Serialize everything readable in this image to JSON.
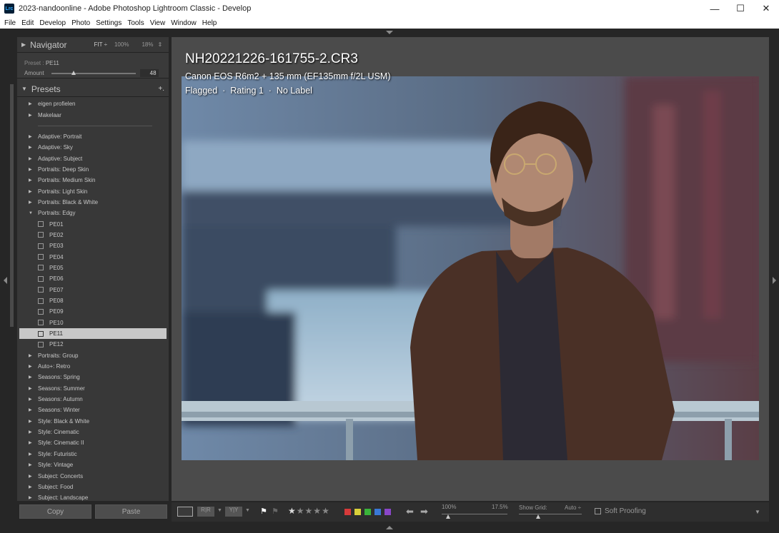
{
  "window": {
    "title": "2023-nandoonline - Adobe Photoshop Lightroom Classic - Develop",
    "app_icon": "Lrc"
  },
  "menu": [
    {
      "label": "File"
    },
    {
      "label": "Edit"
    },
    {
      "label": "Develop"
    },
    {
      "label": "Photo"
    },
    {
      "label": "Settings"
    },
    {
      "label": "Tools"
    },
    {
      "label": "View"
    },
    {
      "label": "Window"
    },
    {
      "label": "Help"
    }
  ],
  "navigator": {
    "title": "Navigator",
    "fit": "FIT ÷",
    "z100": "100%",
    "z18": "18%"
  },
  "preset_amount": {
    "preset_label": "Preset :",
    "preset_value": "PE11",
    "amount_label": "Amount",
    "amount_value": "48"
  },
  "presets": {
    "title": "Presets",
    "add": "+.",
    "items": [
      {
        "label": "eigen profielen",
        "kind": "folder"
      },
      {
        "label": "Makelaar",
        "kind": "folder"
      },
      {
        "label": "",
        "kind": "sep"
      },
      {
        "label": "Adaptive: Portrait",
        "kind": "folder"
      },
      {
        "label": "Adaptive: Sky",
        "kind": "folder"
      },
      {
        "label": "Adaptive: Subject",
        "kind": "folder"
      },
      {
        "label": "Portraits: Deep Skin",
        "kind": "folder"
      },
      {
        "label": "Portraits: Medium Skin",
        "kind": "folder"
      },
      {
        "label": "Portraits: Light Skin",
        "kind": "folder"
      },
      {
        "label": "Portraits: Black & White",
        "kind": "folder"
      },
      {
        "label": "Portraits: Edgy",
        "kind": "open"
      },
      {
        "label": "PE01",
        "kind": "preset"
      },
      {
        "label": "PE02",
        "kind": "preset"
      },
      {
        "label": "PE03",
        "kind": "preset"
      },
      {
        "label": "PE04",
        "kind": "preset"
      },
      {
        "label": "PE05",
        "kind": "preset"
      },
      {
        "label": "PE06",
        "kind": "preset"
      },
      {
        "label": "PE07",
        "kind": "preset"
      },
      {
        "label": "PE08",
        "kind": "preset"
      },
      {
        "label": "PE09",
        "kind": "preset"
      },
      {
        "label": "PE10",
        "kind": "preset"
      },
      {
        "label": "PE11",
        "kind": "preset",
        "selected": true
      },
      {
        "label": "PE12",
        "kind": "preset"
      },
      {
        "label": "Portraits: Group",
        "kind": "folder"
      },
      {
        "label": "Auto+: Retro",
        "kind": "folder"
      },
      {
        "label": "Seasons: Spring",
        "kind": "folder"
      },
      {
        "label": "Seasons: Summer",
        "kind": "folder"
      },
      {
        "label": "Seasons: Autumn",
        "kind": "folder"
      },
      {
        "label": "Seasons: Winter",
        "kind": "folder"
      },
      {
        "label": "Style: Black & White",
        "kind": "folder"
      },
      {
        "label": "Style: Cinematic",
        "kind": "folder"
      },
      {
        "label": "Style: Cinematic II",
        "kind": "folder"
      },
      {
        "label": "Style: Futuristic",
        "kind": "folder"
      },
      {
        "label": "Style: Vintage",
        "kind": "folder"
      },
      {
        "label": "Subject: Concerts",
        "kind": "folder"
      },
      {
        "label": "Subject: Food",
        "kind": "folder"
      },
      {
        "label": "Subject: Landscape",
        "kind": "folder"
      }
    ]
  },
  "buttons": {
    "copy": "Copy",
    "paste": "Paste"
  },
  "photo_info": {
    "filename": "NH20221226-161755-2.CR3",
    "camera": "Canon EOS R6m2 + 135 mm (EF135mm f/2L USM)",
    "flag": "Flagged",
    "rating": "Rating 1",
    "label": "No Label"
  },
  "toolbar": {
    "zoom_a": "100%",
    "zoom_b": "17.5%",
    "show_grid_label": "Show Grid:",
    "show_grid_value": "Auto ÷",
    "soft_proofing": "Soft Proofing",
    "label_colors": [
      "#d63a3a",
      "#d8d03a",
      "#3ab43a",
      "#3a78d6",
      "#8a46c8"
    ]
  },
  "colors": {
    "panel": "#383838",
    "bg": "#262626",
    "main": "#4b4b4b",
    "selected": "#c8c8c8"
  }
}
